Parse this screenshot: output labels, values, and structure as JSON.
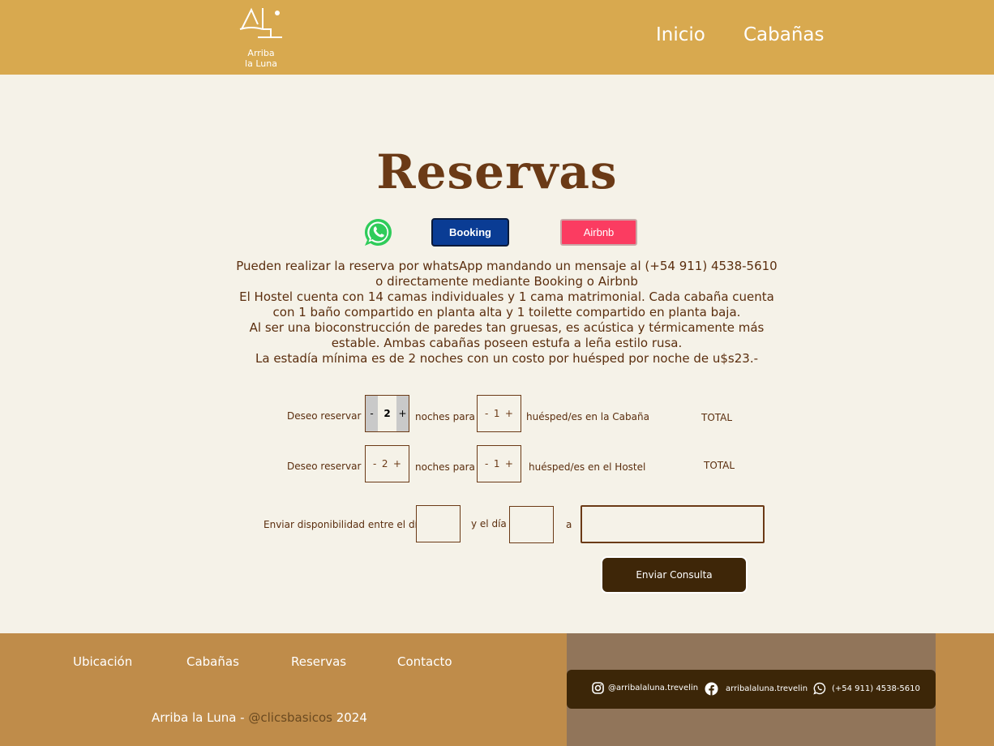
{
  "header": {
    "logo_text_1": "Arriba",
    "logo_text_2": "la Luna",
    "nav": [
      "Inicio",
      "Cabañas"
    ]
  },
  "main": {
    "title": "Reservas",
    "booking_label": "Booking",
    "airbnb_label": "Airbnb",
    "description": [
      "Pueden realizar la reserva por whatsApp mandando un mensaje al (+54 911) 4538-5610",
      "o directamente mediante Booking o Airbnb",
      "El Hostel cuenta con 14 camas individuales y 1 cama matrimonial. Cada cabaña cuenta",
      "con 1 baño compartido en planta alta y 1 toilette compartido en planta baja.",
      "Al ser una bioconstrucción de paredes tan gruesas, es acústica y térmicamente más",
      "estable. Ambas cabañas poseen estufa a leña estilo rusa.",
      "La estadía mínima es de 2 noches con un costo por huésped por noche de u$s23.-"
    ]
  },
  "form": {
    "row1": {
      "prefix": "Deseo reservar",
      "nights": "2",
      "mid": "noches para",
      "guests": "1",
      "suffix": "huésped/es en la Cabaña",
      "total": "TOTAL"
    },
    "row2": {
      "prefix": "Deseo reservar",
      "nights": "2",
      "mid": "noches para",
      "guests": "1",
      "suffix": "huésped/es en el Hostel",
      "total": "TOTAL"
    },
    "minus": "-",
    "plus": "+",
    "avail_label": "Enviar disponibilidad entre el día",
    "and_label": "y el día",
    "to_label": "a",
    "submit_label": "Enviar Consulta"
  },
  "footer": {
    "links": [
      "Ubicación",
      "Cabañas",
      "Reservas",
      "Contacto"
    ],
    "copy_prefix": "Arriba la Luna - ",
    "copy_handle": "@clicsbasicos",
    "copy_year": " 2024",
    "instagram": "@arribalaluna.trevelin",
    "facebook": "arribalaluna.trevelin",
    "whatsapp": "(+54 911) 4538-5610"
  },
  "colors": {
    "header_bg": "#d8a94f",
    "page_bg": "#f5f2e8",
    "title": "#6b3a16",
    "booking": "#0a3c94",
    "airbnb": "#fb3c61",
    "submit_bg": "#3e2608",
    "footer_bg": "#bf8c4a",
    "footer_right_bg": "#91755a",
    "social_bar_bg": "#3c2608"
  }
}
